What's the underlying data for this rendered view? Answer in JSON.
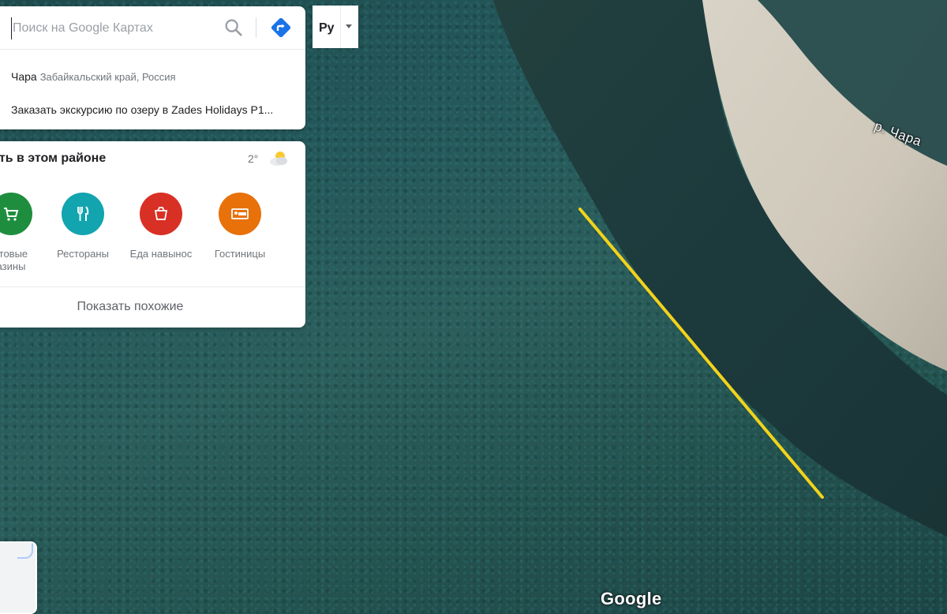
{
  "search": {
    "placeholder": "Поиск на Google Картах"
  },
  "suggestions": [
    {
      "primary": "Чара",
      "secondary": "Забайкальский край, Россия"
    },
    {
      "primary": "Заказать экскурсию по озеру в Zades Holidays Р1...",
      "secondary": ""
    }
  ],
  "language": {
    "label": "Py"
  },
  "explore": {
    "title": "ать в этом районе",
    "temperature": "2°",
    "weather_icon": "partly-cloudy-icon",
    "categories": [
      {
        "label": "ктовые\nазины",
        "icon": "cart-icon",
        "color": "#1e8e3e"
      },
      {
        "label": "Рестораны",
        "icon": "fork-knife-icon",
        "color": "#12a4af"
      },
      {
        "label": "Еда навынос",
        "icon": "takeout-icon",
        "color": "#d93025"
      },
      {
        "label": "Гостиницы",
        "icon": "bed-icon",
        "color": "#e8710a"
      }
    ],
    "show_similar": "Показать похожие"
  },
  "map": {
    "river_label": "р. Чара",
    "logo": "Google",
    "measure_line_color": "#f2d31b"
  }
}
